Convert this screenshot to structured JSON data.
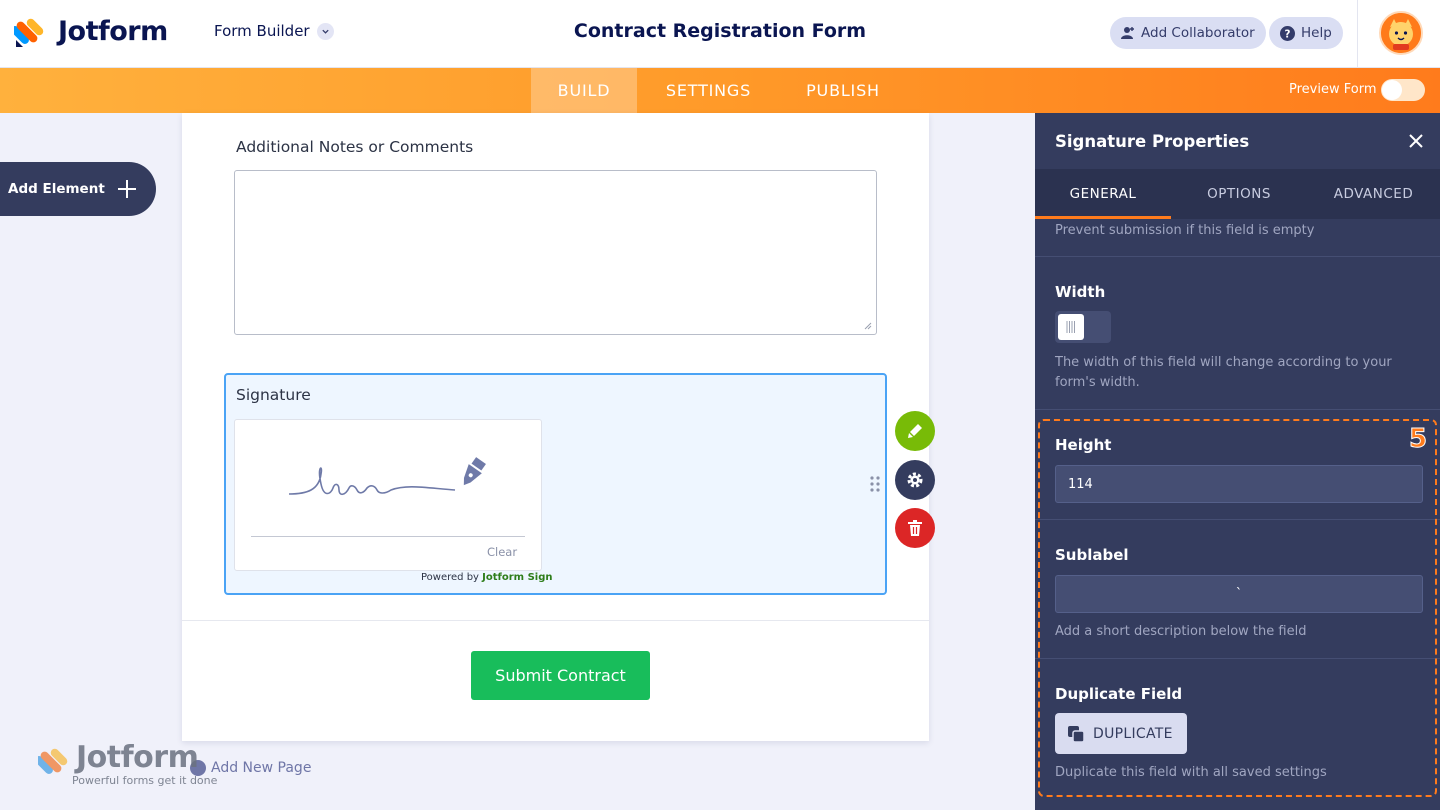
{
  "header": {
    "logo_text": "Jotform",
    "form_builder_label": "Form Builder",
    "form_title": "Contract Registration Form",
    "add_collaborator_label": "Add Collaborator",
    "help_label": "Help"
  },
  "nav": {
    "tabs": [
      {
        "label": "BUILD",
        "active": true
      },
      {
        "label": "SETTINGS",
        "active": false
      },
      {
        "label": "PUBLISH",
        "active": false
      }
    ],
    "preview_label": "Preview Form",
    "preview_enabled": false
  },
  "canvas": {
    "add_element_label": "Add Element",
    "notes_label": "Additional Notes or Comments",
    "signature_label": "Signature",
    "clear_label": "Clear",
    "powered_prefix": "Powered by",
    "powered_brand": "Jotform Sign",
    "submit_label": "Submit Contract",
    "add_page_label": "Add New Page",
    "watermark_text": "Jotform",
    "watermark_tagline": "Powerful forms get it done"
  },
  "panel": {
    "title": "Signature Properties",
    "tabs": [
      {
        "label": "GENERAL",
        "active": true
      },
      {
        "label": "OPTIONS",
        "active": false
      },
      {
        "label": "ADVANCED",
        "active": false
      }
    ],
    "required_help": "Prevent submission if this field is empty",
    "width_title": "Width",
    "width_help": "The width of this field will change according to your form's width.",
    "height_title": "Height",
    "height_value": "114",
    "sublabel_title": "Sublabel",
    "sublabel_value": "`",
    "sublabel_help": "Add a short description below the field",
    "duplicate_title": "Duplicate Field",
    "duplicate_label": "DUPLICATE",
    "duplicate_help": "Duplicate this field with all saved settings",
    "step_number": "5"
  },
  "colors": {
    "accent_orange": "#ff7b1c",
    "panel_bg": "#343c5e",
    "submit_green": "#18bd5b",
    "selected_border": "#4aa3f5"
  }
}
